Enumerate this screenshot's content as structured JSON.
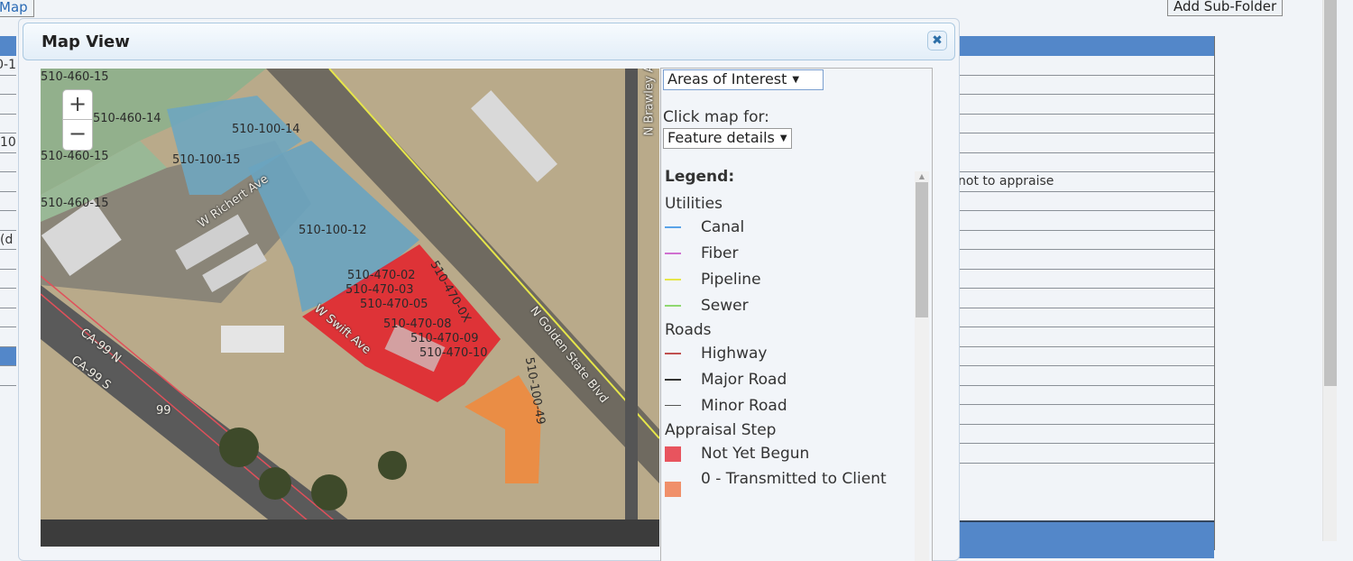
{
  "background": {
    "map_button": "Map",
    "add_subfolder_button": "Add Sub-Folder",
    "left_rows": [
      "0-1",
      "",
      "",
      "",
      "10",
      "",
      "",
      "",
      "",
      "d)",
      "",
      "",
      "",
      "",
      "",
      "",
      ""
    ],
    "right_rows": [
      "",
      "",
      "",
      "",
      "",
      "",
      "not to appraise",
      "",
      "",
      "",
      "",
      "",
      "",
      "",
      "",
      "",
      "",
      "",
      "",
      "",
      ""
    ]
  },
  "dialog": {
    "title": "Map View",
    "close_icon": "close-icon",
    "layer_select": "Areas of Interest",
    "click_map_label": "Click map for:",
    "click_select": "Feature details",
    "zoom_in": "+",
    "zoom_out": "−",
    "legend": {
      "title": "Legend:",
      "groups": [
        {
          "name": "Utilities",
          "items": [
            {
              "label": "Canal",
              "color": "#5aa3e8",
              "kind": "line"
            },
            {
              "label": "Fiber",
              "color": "#d070d0",
              "kind": "line"
            },
            {
              "label": "Pipeline",
              "color": "#e6e64a",
              "kind": "line"
            },
            {
              "label": "Sewer",
              "color": "#8fd870",
              "kind": "line"
            }
          ]
        },
        {
          "name": "Roads",
          "items": [
            {
              "label": "Highway",
              "color": "#c05050",
              "kind": "line"
            },
            {
              "label": "Major Road",
              "color": "#333333",
              "kind": "line"
            },
            {
              "label": "Minor Road",
              "color": "#555555",
              "kind": "thinline"
            }
          ]
        },
        {
          "name": "Appraisal Step",
          "items": [
            {
              "label": "Not Yet Begun",
              "color": "#e8545e",
              "kind": "swatch"
            },
            {
              "label": "0 - Transmitted to Client",
              "color": "#f0906a",
              "kind": "swatch"
            }
          ]
        }
      ]
    },
    "map_labels": {
      "parcels": [
        "510-460-15",
        "510-460-14",
        "510-460-15",
        "510-460-15",
        "510-100-14",
        "510-100-15",
        "510-100-12",
        "510-470-02",
        "510-470-03",
        "510-470-05",
        "510-470-0X",
        "510-470-08",
        "510-470-09",
        "510-470-10",
        "510-100-49"
      ],
      "streets": [
        "W Richert Ave",
        "W Swift Ave",
        "N Golden State Blvd",
        "N Brawley Ave",
        "CA-99 N",
        "CA-99 S",
        "99"
      ]
    }
  }
}
